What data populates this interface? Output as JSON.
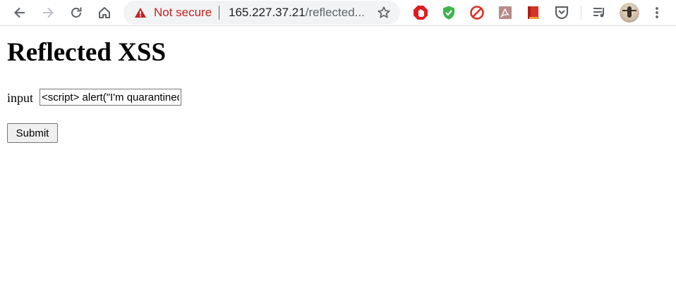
{
  "browser": {
    "security_label": "Not secure",
    "url_host": "165.227.37.21",
    "url_rest": "/reflected...",
    "extensions": [
      "adblock-icon",
      "shield-check-icon",
      "block-icon",
      "pdf-icon",
      "book-icon",
      "pocket-icon"
    ],
    "colors": {
      "warning": "#c5221f",
      "omnibox_bg": "#f1f3f4"
    }
  },
  "page": {
    "title": "Reflected XSS",
    "input_label": "input",
    "input_value": "<script> alert(\"I'm quarantined\")",
    "submit_label": "Submit"
  }
}
